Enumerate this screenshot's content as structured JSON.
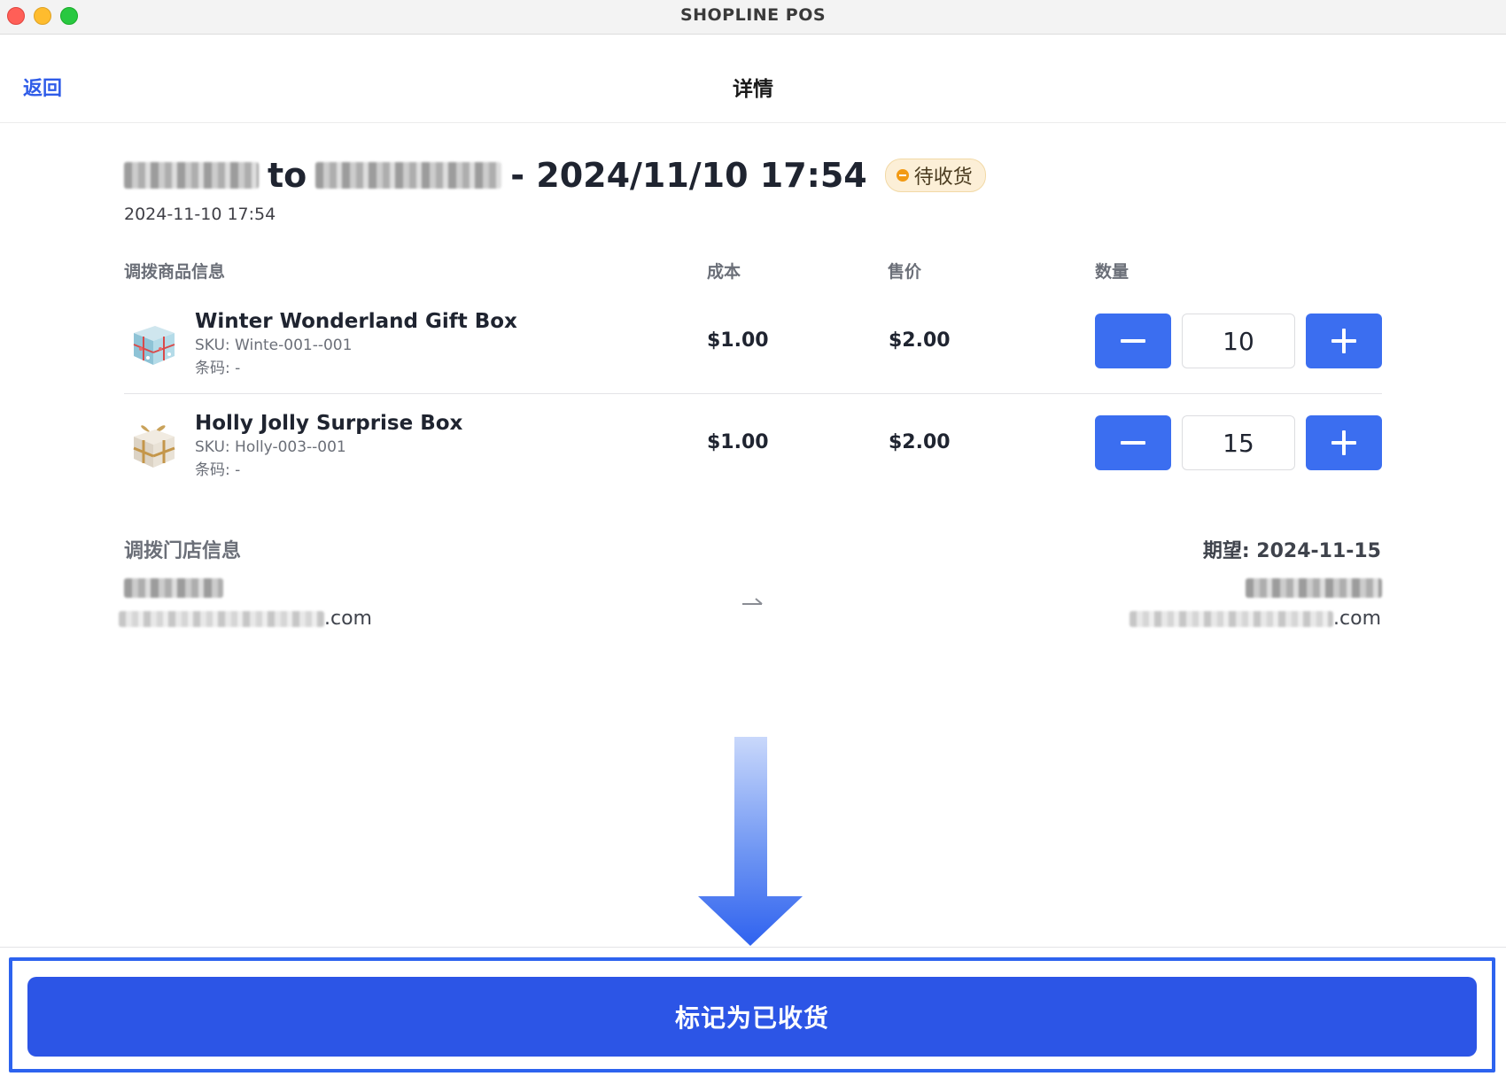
{
  "window": {
    "title": "SHOPLINE POS"
  },
  "nav": {
    "back_label": "返回",
    "title": "详情"
  },
  "transfer": {
    "connector": "to",
    "datetime": "- 2024/11/10 17:54",
    "status": "待收货",
    "created": "2024-11-10 17:54"
  },
  "table": {
    "headers": {
      "product": "调拨商品信息",
      "cost": "成本",
      "price": "售价",
      "quantity": "数量"
    },
    "rows": [
      {
        "name": "Winter Wonderland Gift Box",
        "sku": "SKU: Winte-001--001",
        "barcode": "条码: -",
        "cost": "$1.00",
        "price": "$2.00",
        "quantity": "10"
      },
      {
        "name": "Holly Jolly Surprise Box",
        "sku": "SKU: Holly-003--001",
        "barcode": "条码: -",
        "cost": "$1.00",
        "price": "$2.00",
        "quantity": "15"
      }
    ]
  },
  "stores": {
    "heading": "调拨门店信息",
    "expected": "期望: 2024-11-15",
    "from": {
      "email_suffix": ".com"
    },
    "to": {
      "email_suffix": ".com"
    }
  },
  "footer": {
    "primary_label": "标记为已收货"
  },
  "colors": {
    "accent": "#2c55e6",
    "stepper": "#3b6ef0",
    "badge_bg": "#fcefd7",
    "badge_dot": "#f29a14"
  },
  "icons": [
    "minus-icon",
    "plus-icon",
    "arrow-right-icon",
    "arrow-down-annotation",
    "pending-status-icon",
    "gift-box-thumbnail"
  ]
}
